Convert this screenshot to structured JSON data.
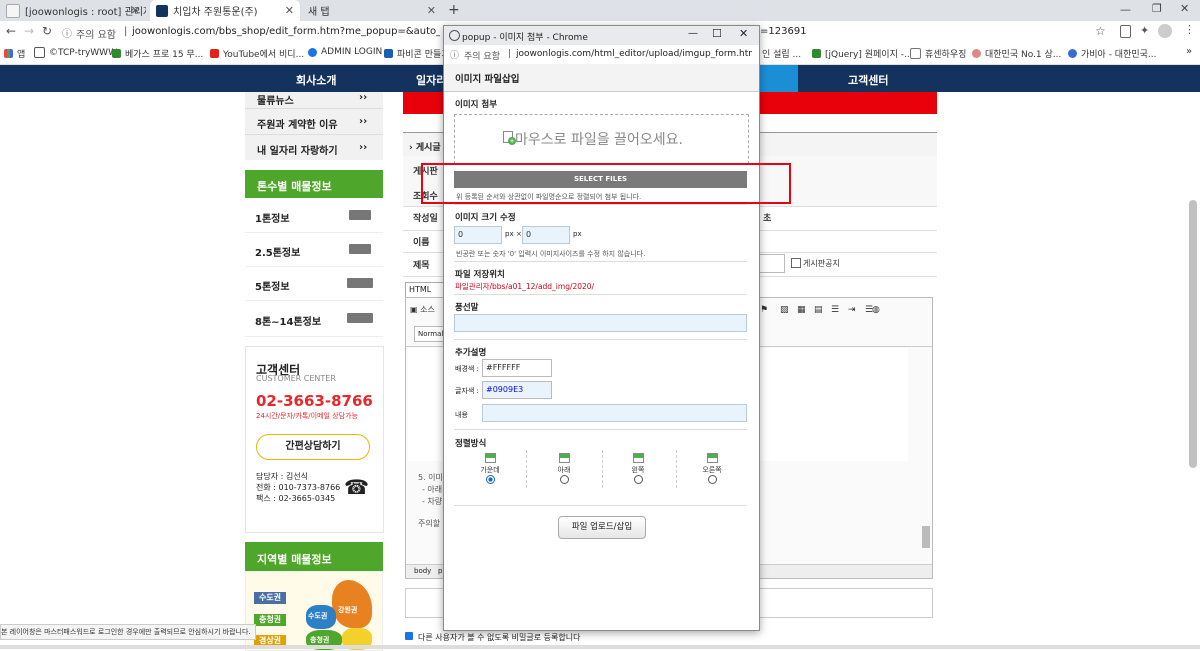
{
  "browser": {
    "tabs": [
      {
        "label": "[joowonlogis : root] 관리자 페이"
      },
      {
        "label": "치입차 주원통운(주)"
      },
      {
        "label": "새 탭"
      }
    ],
    "security_label": "주의 요함",
    "url": "joowonlogis.com/bbs_shop/edit_form.htm?me_popup=&auto_frame=&cate_su",
    "url_tail": "=123691",
    "bookmarks": [
      "앱",
      "©TCP-tryWWW",
      "베가스 프로 15 무...",
      "YouTube에서 비디...",
      "ADMIN LOGIN",
      "파비콘 만들기",
      "[jQuery] 원페이지 -...",
      "휴센하우징",
      "대한민국 No.1 상...",
      "가비아 - 대한민국..."
    ],
    "bookmark_partial": "인 설립 ..."
  },
  "site": {
    "nav": [
      "회사소개",
      "일자리",
      "고객센터"
    ],
    "menu": [
      "물류뉴스",
      "주원과 계약한 이유",
      "내 일자리 자랑하기"
    ],
    "menu_arrow": "››",
    "tonnage_title": "톤수별 매물정보",
    "tonnage": [
      "1톤정보",
      "2.5톤정보",
      "5톤정보",
      "8톤~14톤정보"
    ],
    "cs_title": "고객센터",
    "cs_sub": "CUSTOMER CENTER",
    "cs_phone": "02-3663-8766",
    "cs_hours": "24시간/문자/카톡/이메일 상담가능",
    "cs_button": "간편상담하기",
    "cs_manager": "담당자 : 김선식",
    "cs_tel": "전화 : 010-7373-8766",
    "cs_fax": "팩스 : 02-3665-0345",
    "region_title": "지역별 매물정보",
    "region_tags": [
      "수도권",
      "충청권",
      "경상권"
    ],
    "map_labels": [
      "수도권",
      "강원권",
      "충청권"
    ],
    "status_text": "본 레이어창은 마스터패스워드로 로그인한 경우에만 출력되므로 안심하시기 바랍니다.",
    "form_labels": [
      "게시글",
      "게시판",
      "조회수",
      "작성일",
      "이름",
      "제목"
    ],
    "notice_checkbox": "게시판공지",
    "html_tab": "HTML",
    "editor_source": "소스",
    "editor_format": "Normal",
    "editor_status": [
      "body",
      "p"
    ],
    "step_text": "5. 이미",
    "step_lines": [
      "- 아래",
      "- 차량"
    ],
    "notice_short": "주의할",
    "time_suffix": "초",
    "bottom_check": "다른 사용자가 볼 수 없도록 비밀글로 등록합니다"
  },
  "popup": {
    "window_title": "popup - 이미지 첨부 - Chrome",
    "security_label": "주의 요함",
    "url": "joowonlogis.com/html_editor/upload/imgup_form.htm?...",
    "heading": "이미지 파일삽입",
    "attach_label": "이미지 첨부",
    "drop_text": "마우스로 파일을 끌어오세요.",
    "select_files": "SELECT FILES",
    "order_note": "위 등록된 순서와 상관없이 파일명순으로 정렬되어 첨부 됩니다.",
    "resize_label": "이미지 크기 수정",
    "width_value": "0",
    "height_value": "0",
    "unit_px": "px",
    "times": "×",
    "resize_note": "빈공란 또는 숫자 '0' 입력시 이미지사이즈를 수정 하지 않습니다.",
    "save_label": "파일 저장위치",
    "save_path": "파일관리자/bbs/a01_12/add_img/2020/",
    "balloon_label": "풍선말",
    "balloon_value": "",
    "extra_label": "추가설명",
    "bg_label": "배경색 :",
    "bg_value": "#FFFFFF",
    "fg_label": "글자색 :",
    "fg_value": "#0909E3",
    "content_label": "내용",
    "content_value": "",
    "align_label": "정렬방식",
    "align_options": [
      "가운데",
      "아래",
      "왼쪽",
      "오른쪽"
    ],
    "align_selected": "가운데",
    "upload_button": "파일 업로드/삽입"
  },
  "colors": {
    "nav_bg": "#14325e",
    "accent_green": "#4ea62a",
    "phone_red": "#e8262b",
    "banner_red": "#e8000b",
    "highlight_box": "#e30613"
  }
}
